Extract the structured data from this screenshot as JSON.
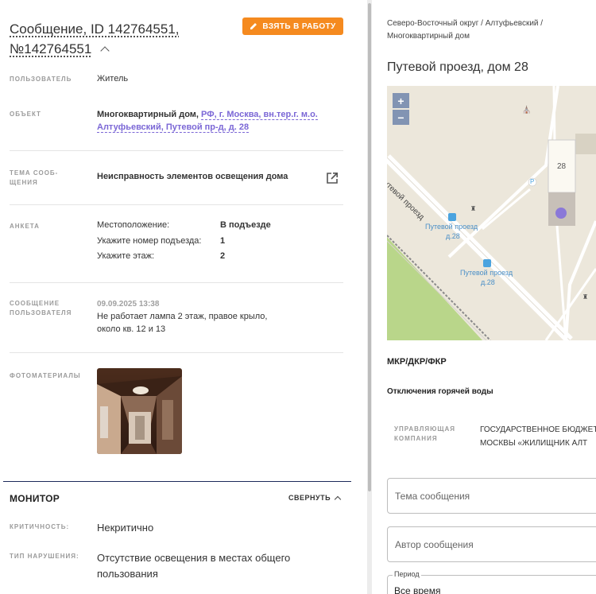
{
  "message": {
    "title": "Сообщение, ID 142764551, №142764551",
    "take_button": "ВЗЯТЬ В РАБОТУ"
  },
  "fields": {
    "user_label": "ПОЛЬЗОВАТЕЛЬ",
    "user_value": "Житель",
    "object_label": "ОБЪЕКТ",
    "object_type": "Многоквартирный дом,",
    "object_link": "РФ, г. Москва, вн.тер.г. м.о. Алтуфьевский, Путевой пр-д, д. 28",
    "topic_label": "ТЕМА СООБ- ЩЕНИЯ",
    "topic_value": "Неисправность элементов освещения дома",
    "survey_label": "АНКЕТА",
    "survey_rows": [
      {
        "k": "Местоположение:",
        "v": "В подъезде"
      },
      {
        "k": "Укажите номер подъезда:",
        "v": "1"
      },
      {
        "k": "Укажите этаж:",
        "v": "2"
      }
    ],
    "user_msg_label": "СООБЩЕНИЕ ПОЛЬЗОВАТЕЛЯ",
    "user_msg_date": "09.09.2025 13:38",
    "user_msg_text": "Не работает лампа 2 этаж, правое крыло, около кв. 12 и 13",
    "photo_label": "ФОТОМАТЕРИАЛЫ"
  },
  "monitor": {
    "title": "МОНИТОР",
    "collapse": "СВЕРНУТЬ",
    "criticality_label": "КРИТИЧНОСТЬ:",
    "criticality_value": "Некритично",
    "violation_label": "ТИП НАРУШЕНИЯ:",
    "violation_value": "Отсутствие освещения в местах общего пользования"
  },
  "right": {
    "breadcrumb": "Северо-Восточный округ / Алтуфьевский / Многоквартирный дом",
    "address": "Путевой проезд, дом 28",
    "map": {
      "zoom_in": "+",
      "zoom_out": "−",
      "building_number": "28",
      "road_label": "Путевой проезд",
      "stop1_label": "Путевой проезд",
      "stop1_sub": "д.28",
      "stop2_label": "Путевой проезд",
      "stop2_sub": "д.28",
      "parking": "P"
    },
    "mkr_label": "МКР/ДКР/ФКР",
    "hot_water_label": "Отключения горячей воды",
    "uk_label": "УПРАВЛЯЮЩАЯ КОМПАНИЯ",
    "uk_value_line1": "ГОСУДАРСТВЕННОЕ БЮДЖЕТ",
    "uk_value_line2": "МОСКВЫ «ЖИЛИЩНИК АЛТ",
    "field_topic_placeholder": "Тема сообщения",
    "field_author_placeholder": "Автор сообщения",
    "period_legend": "Период",
    "period_value": "Все время"
  }
}
